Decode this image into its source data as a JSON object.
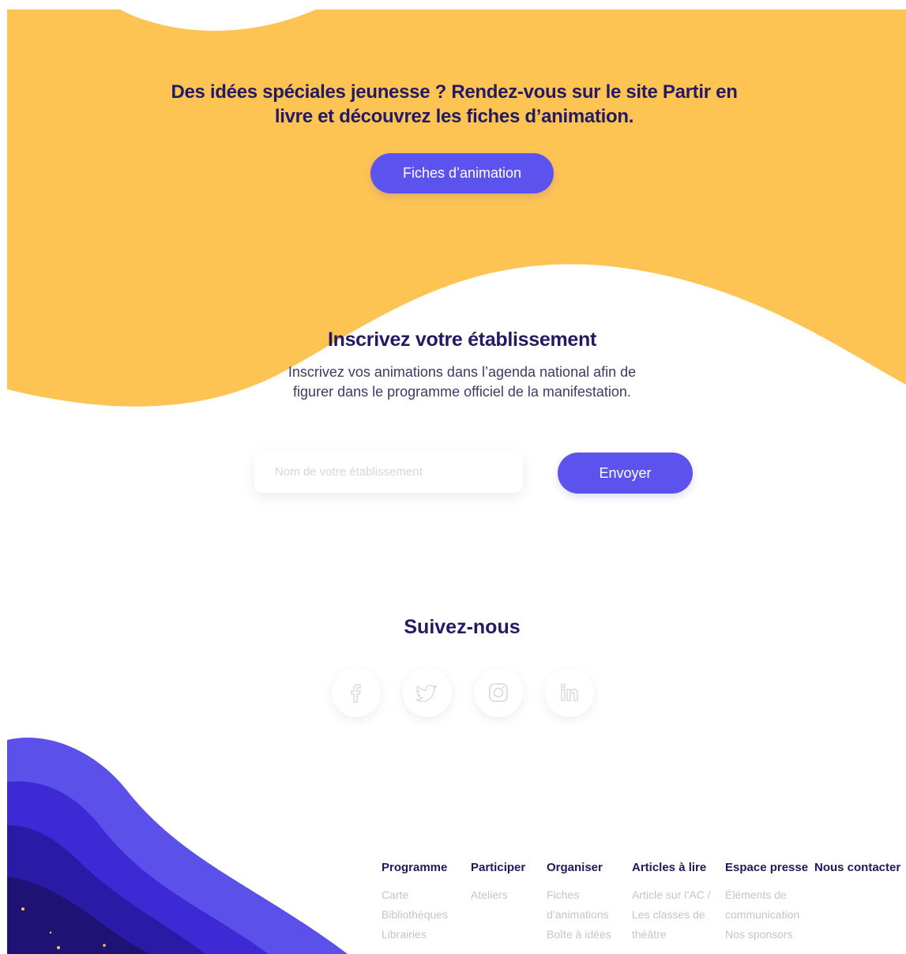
{
  "hero": {
    "title": "Des idées spéciales jeunesse ? Rendez-vous sur le site Partir en livre et découvrez les fiches d’animation.",
    "button_label": "Fiches d’animation"
  },
  "register": {
    "title": "Inscrivez votre établissement",
    "text": "Inscrivez vos animations dans l’agenda national afin de figurer dans le programme officiel de la manifestation.",
    "input_placeholder": "Nom de votre établissement",
    "input_value": "",
    "submit_label": "Envoyer"
  },
  "follow": {
    "title": "Suivez-nous",
    "icons": [
      "facebook-icon",
      "twitter-icon",
      "instagram-icon",
      "linkedin-icon"
    ]
  },
  "footer": {
    "columns": [
      {
        "heading": "Programme",
        "links": [
          "Carte",
          "Bibliothèques",
          "Librairies"
        ]
      },
      {
        "heading": "Participer",
        "links": [
          "Ateliers"
        ]
      },
      {
        "heading": "Organiser",
        "links": [
          "Fiches d’animations",
          "Boîte à idées"
        ]
      },
      {
        "heading": "Articles à lire",
        "links": [
          "Article sur l’AC / Les classes de théâtre"
        ]
      },
      {
        "heading": "Espace presse",
        "links": [
          "Éléments de communication",
          "Nos sponsors"
        ]
      },
      {
        "heading": "Nous contacter",
        "links": []
      }
    ]
  },
  "colors": {
    "yellow": "#fdc454",
    "accent": "#5c52ee",
    "navy": "#231a63",
    "muted": "#c4c4ca"
  }
}
